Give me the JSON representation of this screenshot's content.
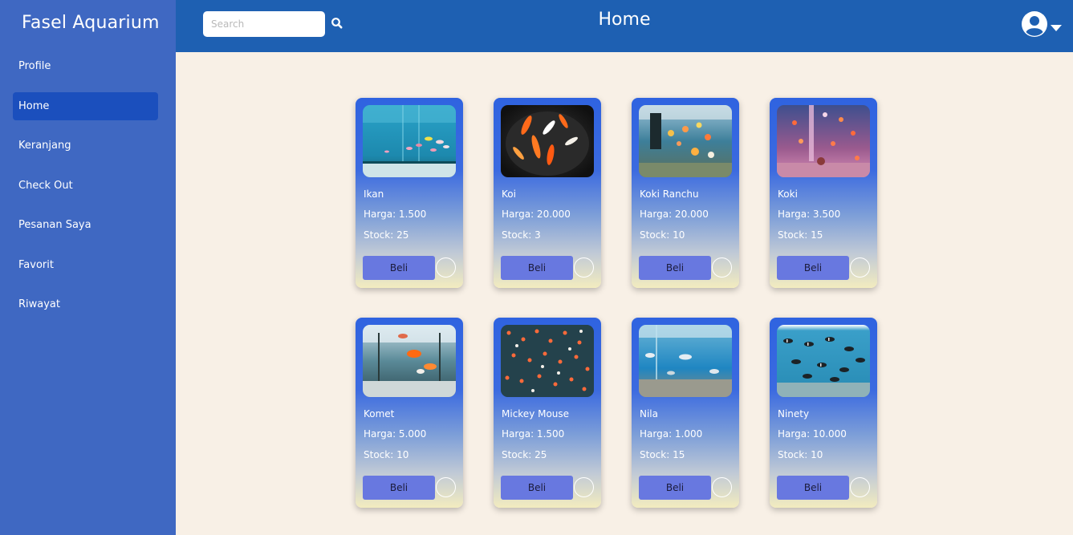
{
  "app": {
    "brand": "Fasel Aquarium",
    "page_title": "Home"
  },
  "sidebar": {
    "items": [
      {
        "label": "Profile"
      },
      {
        "label": "Home"
      },
      {
        "label": "Keranjang"
      },
      {
        "label": "Check Out"
      },
      {
        "label": "Pesanan Saya"
      },
      {
        "label": "Favorit"
      },
      {
        "label": "Riwayat"
      }
    ],
    "active": "Home"
  },
  "search": {
    "placeholder": "Search",
    "value": ""
  },
  "icons": {
    "search": "search-icon",
    "account": "user-circle-icon",
    "dropdown": "caret-down-icon",
    "favorite": "circle-toggle-icon"
  },
  "colors": {
    "sidebar": "#3f68c2",
    "topbar": "#1e60b2",
    "active_item": "#1b4fbd",
    "background": "#f8f0e6",
    "buy_button": "#6878e0"
  },
  "products": [
    {
      "name": "Ikan",
      "price": "Harga: 1.500",
      "stock": "Stock: 25",
      "buy_label": "Beli"
    },
    {
      "name": "Koi",
      "price": "Harga: 20.000",
      "stock": "Stock: 3",
      "buy_label": "Beli"
    },
    {
      "name": "Koki Ranchu",
      "price": "Harga: 20.000",
      "stock": "Stock: 10",
      "buy_label": "Beli"
    },
    {
      "name": "Koki",
      "price": "Harga: 3.500",
      "stock": "Stock: 15",
      "buy_label": "Beli"
    },
    {
      "name": "Komet",
      "price": "Harga: 5.000",
      "stock": "Stock: 10",
      "buy_label": "Beli"
    },
    {
      "name": "Mickey Mouse",
      "price": "Harga: 1.500",
      "stock": "Stock: 25",
      "buy_label": "Beli"
    },
    {
      "name": "Nila",
      "price": "Harga: 1.000",
      "stock": "Stock: 15",
      "buy_label": "Beli"
    },
    {
      "name": "Ninety",
      "price": "Harga: 10.000",
      "stock": "Stock: 10",
      "buy_label": "Beli"
    }
  ]
}
